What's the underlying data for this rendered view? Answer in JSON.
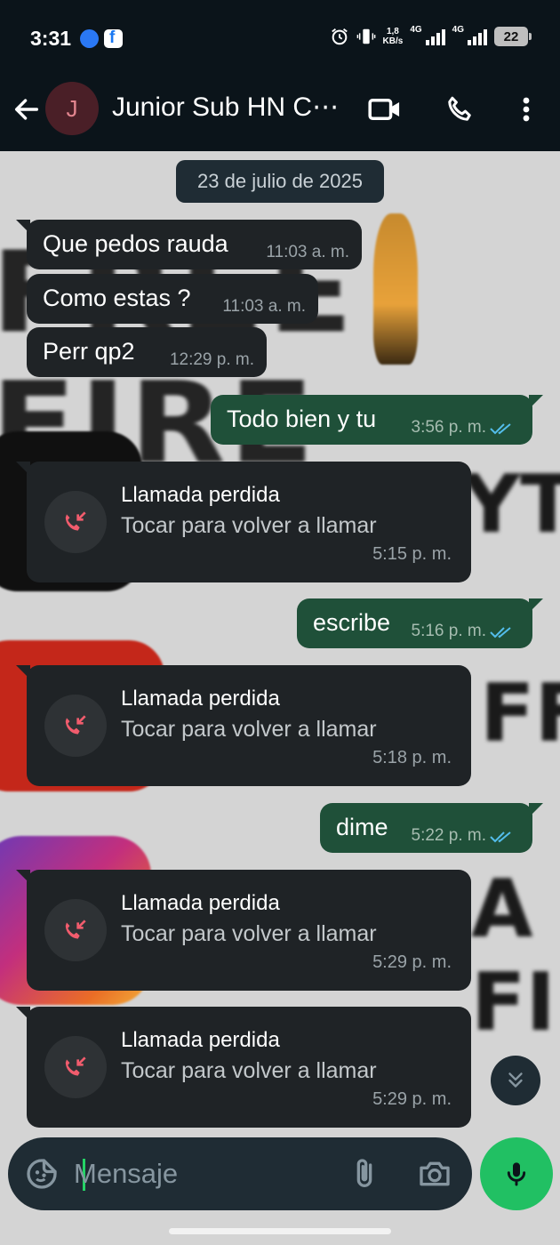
{
  "status_bar": {
    "time": "3:31",
    "net_speed_value": "1,8",
    "net_speed_unit": "KB/s",
    "sim1": "4G",
    "sim2": "4G",
    "battery": "22",
    "icons": [
      "messenger-icon",
      "facebook-icon",
      "alarm-icon",
      "vibrate-icon",
      "signal-icon",
      "battery-icon"
    ]
  },
  "header": {
    "avatar_initial": "J",
    "contact_name": "Junior Sub HN C⋯",
    "icons": [
      "back-arrow-icon",
      "video-call-icon",
      "phone-icon",
      "more-vert-icon"
    ]
  },
  "chat": {
    "date_chip": "23 de julio de 2025",
    "messages": [
      {
        "text": "Que pedos rauda",
        "time": "11:03 a. m."
      },
      {
        "text": "Como estas ?",
        "time": "11:03 a. m."
      },
      {
        "text": "Perr qp2",
        "time": "12:29 p. m."
      },
      {
        "text": "Todo bien y tu",
        "time": "3:56 p. m."
      },
      {
        "text": "escribe",
        "time": "5:16 p. m."
      },
      {
        "text": "dime",
        "time": "5:22 p. m."
      }
    ],
    "missed_calls": [
      {
        "title": "Llamada perdida",
        "subtitle": "Tocar para volver a llamar",
        "time": "5:15 p. m."
      },
      {
        "title": "Llamada perdida",
        "subtitle": "Tocar para volver a llamar",
        "time": "5:18 p. m."
      },
      {
        "title": "Llamada perdida",
        "subtitle": "Tocar para volver a llamar",
        "time": "5:29 p. m."
      },
      {
        "title": "Llamada perdida",
        "subtitle": "Tocar para volver a llamar",
        "time": "5:29 p. m."
      }
    ]
  },
  "composer": {
    "placeholder": "Mensaje",
    "icons": [
      "sticker-icon",
      "attach-icon",
      "camera-icon",
      "mic-icon"
    ]
  },
  "colors": {
    "header_bg": "#0b141a",
    "incoming_bubble": "#1f2326",
    "outgoing_bubble": "#1f5039",
    "read_ticks": "#53bdeb",
    "missed_call_red": "#f15c6d",
    "mic_button": "#21c063"
  }
}
